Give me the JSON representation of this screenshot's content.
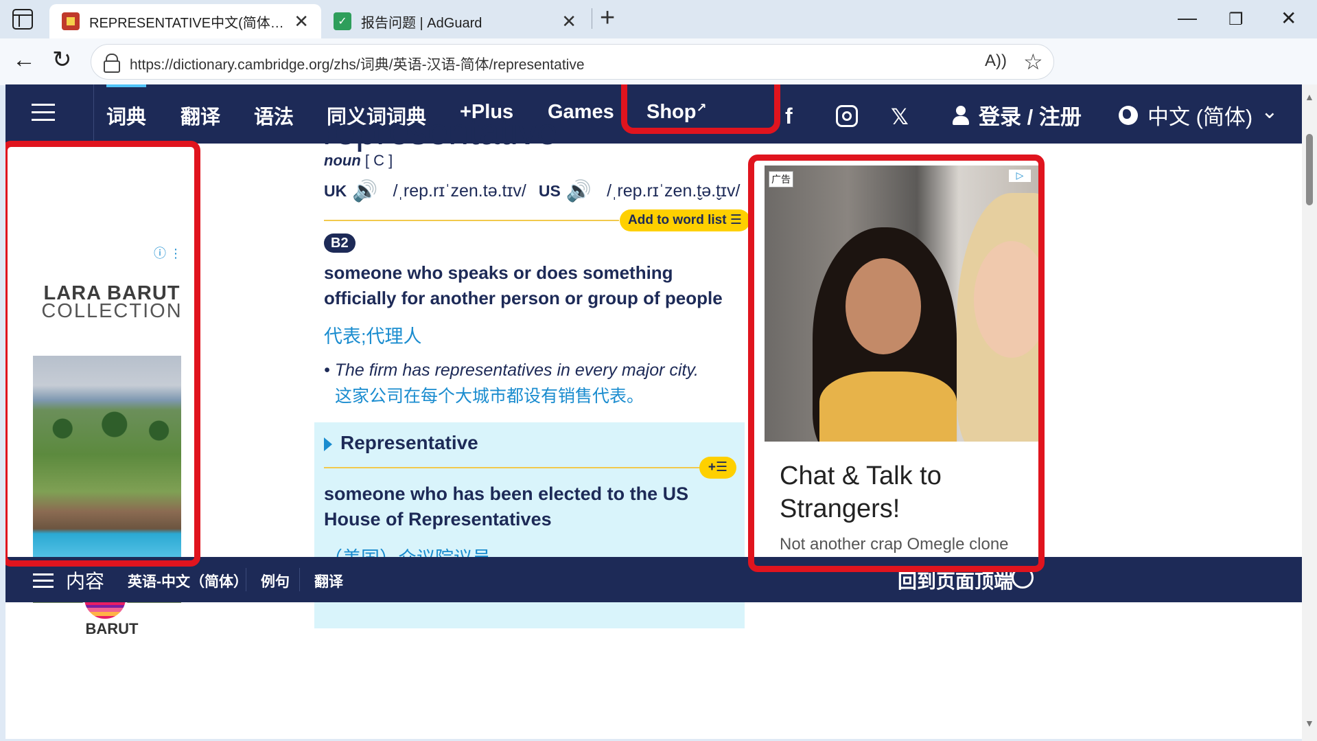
{
  "browser": {
    "tabs": [
      {
        "title": "REPRESENTATIVE中文(简体)翻译：",
        "active": true,
        "favicon": "cambridge-shield-icon"
      },
      {
        "title": "报告问题 | AdGuard",
        "active": false,
        "favicon": "adguard-shield-icon"
      }
    ],
    "close_glyph": "✕",
    "new_tab_glyph": "+",
    "url": "https://dictionary.cambridge.org/zhs/词典/英语-汉语-简体/representative",
    "read_aloud_glyph": "A))",
    "favorite_glyph": "☆",
    "back_glyph": "←",
    "reload_glyph": "↻",
    "win_min": "—",
    "win_max": "❐",
    "win_close": "✕"
  },
  "site_nav": {
    "items": [
      "词典",
      "翻译",
      "语法",
      "同义词词典",
      "+Plus",
      "Games",
      "Shop"
    ],
    "shop_ext_glyph": "↗",
    "social": {
      "facebook": "f",
      "x": "𝕏"
    },
    "login": "登录 / 注册",
    "language": "中文 (简体)",
    "language_chevron": "⌄"
  },
  "left_ad": {
    "info_glyph": "ⓘ ⋮",
    "brand_line1": "LARA BARUT",
    "brand_line2": "COLLECTION",
    "logo_text": "BARUT"
  },
  "entry": {
    "headword": "representative",
    "pos": "noun",
    "grammar": "[ C ]",
    "uk_label": "UK",
    "uk_ipa": "/ˌrep.rɪˈzen.tə.tɪv/",
    "us_label": "US",
    "us_ipa": "/ˌrep.rɪˈzen.t̬ə.t̬ɪv/",
    "speaker_glyph": "🔊",
    "add_to_word_list": "Add to word list ☰",
    "level": "B2",
    "definition": "someone who speaks or does something officially for another person or group of people",
    "translation": "代表;代理人",
    "example": "• The firm has representatives in every major city.",
    "example_translation": "这家公司在每个大城市都设有销售代表。",
    "sense2_title": "Representative",
    "sense2_add": "+☰",
    "sense2_definition": "someone who has been elected to the US House of Representatives",
    "sense2_translation": "（美国）众议院议员"
  },
  "right_ad": {
    "ad_tag": "广告",
    "ad_choices": "▷",
    "headline": "Chat & Talk to Strangers!",
    "subline": "Not another crap Omegle clone"
  },
  "bottom_bar": {
    "contents": "内容",
    "items": [
      "英语-中文（简体）",
      "例句",
      "翻译"
    ],
    "back_to_top": "回到页面顶端"
  },
  "colors": {
    "nav_bg": "#1d2a57",
    "accent_yellow": "#fed000",
    "link_blue": "#1a8ccf",
    "annotation_red": "#e0141e",
    "highlight_box": "#d9f4fb"
  }
}
